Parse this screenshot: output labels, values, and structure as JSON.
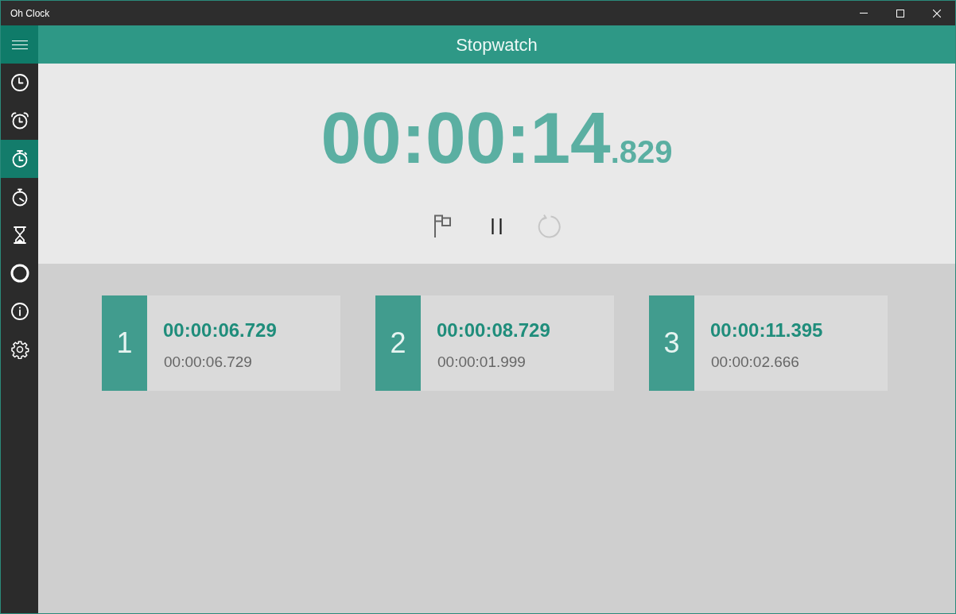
{
  "window": {
    "title": "Oh Clock"
  },
  "sidebar": {
    "items": [
      {
        "kind": "clock",
        "selected": false
      },
      {
        "kind": "alarm",
        "selected": false
      },
      {
        "kind": "stopwatch",
        "selected": true
      },
      {
        "kind": "timer",
        "selected": false
      },
      {
        "kind": "hourglass",
        "selected": false
      },
      {
        "kind": "ring",
        "selected": false
      },
      {
        "kind": "info",
        "selected": false
      },
      {
        "kind": "settings",
        "selected": false
      }
    ]
  },
  "header": {
    "title": "Stopwatch"
  },
  "stopwatch": {
    "time": "00:00:14",
    "fraction": ".829",
    "controls": [
      {
        "kind": "lap",
        "disabled": false
      },
      {
        "kind": "pause",
        "disabled": false
      },
      {
        "kind": "reset",
        "disabled": true
      }
    ]
  },
  "laps": [
    {
      "number": "1",
      "total": "00:00:06.729",
      "split": "00:00:06.729"
    },
    {
      "number": "2",
      "total": "00:00:08.729",
      "split": "00:00:01.999"
    },
    {
      "number": "3",
      "total": "00:00:11.395",
      "split": "00:00:02.666"
    }
  ]
}
